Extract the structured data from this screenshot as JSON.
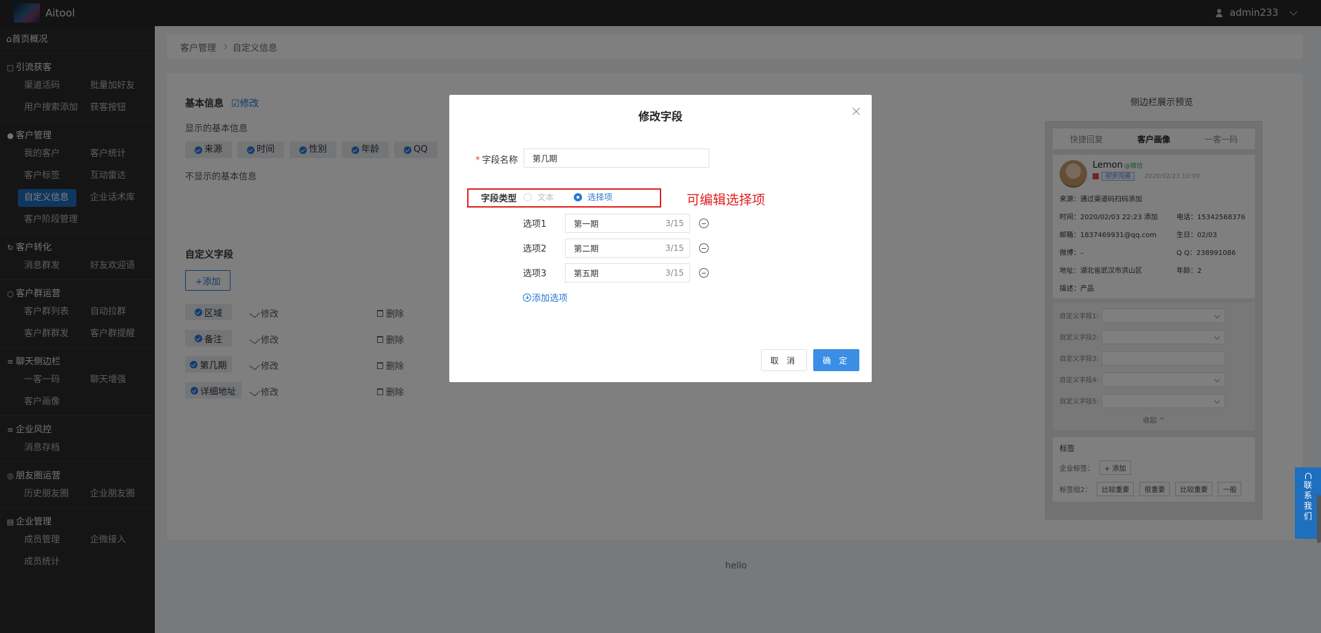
{
  "app": {
    "name": "Aitool",
    "user": "admin233"
  },
  "sidebar": {
    "home": "首页概况",
    "groups": [
      {
        "title": "引流获客",
        "items": [
          "渠道活码",
          "批量加好友",
          "用户搜索添加",
          "获客按钮"
        ]
      },
      {
        "title": "客户管理",
        "items": [
          "我的客户",
          "客户统计",
          "客户标签",
          "互动雷达",
          "自定义信息",
          "企业话术库",
          "客户阶段管理"
        ]
      },
      {
        "title": "客户转化",
        "items": [
          "消息群发",
          "好友欢迎语"
        ]
      },
      {
        "title": "客户群运营",
        "items": [
          "客户群列表",
          "自动拉群",
          "客户群群发",
          "客户群提醒"
        ]
      },
      {
        "title": "聊天侧边栏",
        "items": [
          "一客一码",
          "聊天增强",
          "客户画像"
        ]
      },
      {
        "title": "企业风控",
        "items": [
          "消息存档"
        ]
      },
      {
        "title": "朋友圈运营",
        "items": [
          "历史朋友圈",
          "企业朋友圈"
        ]
      },
      {
        "title": "企业管理",
        "items": [
          "成员管理",
          "企微接入",
          "成员统计"
        ]
      }
    ]
  },
  "breadcrumb": [
    "客户管理",
    "自定义信息"
  ],
  "basic": {
    "title": "基本信息",
    "edit": "修改",
    "shown_label": "显示的基本信息",
    "shown_tags": [
      "来源",
      "时间",
      "性别",
      "年龄",
      "QQ"
    ],
    "hidden_label": "不显示的基本信息"
  },
  "custom": {
    "title": "自定义字段",
    "add": "+添加",
    "fields": [
      "区域",
      "备注",
      "第几期",
      "详细地址"
    ],
    "edit": "修改",
    "delete": "删除"
  },
  "preview": {
    "title": "侧边栏展示预览",
    "tabs": [
      "快捷回复",
      "客户画像",
      "一客一码"
    ],
    "name": "Lemon",
    "wx": "@微信",
    "stage": "初步沟通",
    "date": "2020/02/23 10:09",
    "source": "来源：通过渠道码扫码添加",
    "time": "时间：2020/02/03 22:23 添加",
    "phone": "电话：15342568376",
    "email": "邮箱：1837469931@qq.com",
    "birthday": "生日：02/03",
    "weibo": "微博：–",
    "qq": "Q Q：238991086",
    "address": "地址：湖北省武汉市洪山区",
    "age": "年龄：2",
    "desc": "描述：产品",
    "custom_fields": [
      "自定义字段1:",
      "自定义字段2:",
      "自定义字段3:",
      "自定义字段4:",
      "自定义字段5:"
    ],
    "collapse": "收起 ^",
    "tags_title": "标签",
    "corp_tags": "企业标签：",
    "add_small": "+ 添加",
    "tag_row_label": "标签组2：",
    "tag_row_values": [
      "比较重要",
      "很重要",
      "比较重要",
      "一般"
    ]
  },
  "footer": "hello",
  "modal": {
    "title": "修改字段",
    "name_label": "字段名称",
    "name_value": "第几期",
    "type_label": "字段类型",
    "type_text": "文本",
    "type_select": "选择项",
    "options": [
      {
        "label": "选项1",
        "value": "第一期",
        "count": "3/15"
      },
      {
        "label": "选项2",
        "value": "第二期",
        "count": "3/15"
      },
      {
        "label": "选项3",
        "value": "第五期",
        "count": "3/15"
      }
    ],
    "add_option": "添加选项",
    "cancel": "取 消",
    "ok": "确 定"
  },
  "annotation": "可编辑选择项",
  "contact": [
    "联",
    "系",
    "我",
    "们"
  ],
  "colors": {
    "accent": "#2a77d6",
    "sidebar_active": "#1f6fbf",
    "highlight": "#e02020"
  }
}
